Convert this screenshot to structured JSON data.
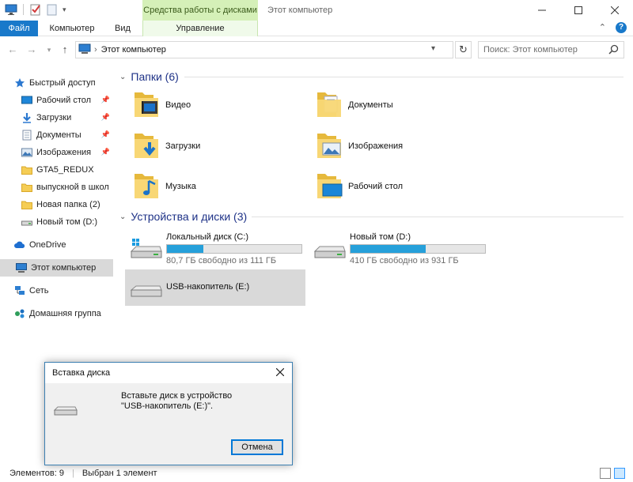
{
  "window": {
    "title": "Этот компьютер",
    "context_tab_header": "Средства работы с дисками"
  },
  "ribbon": {
    "tabs": [
      {
        "label": "Файл"
      },
      {
        "label": "Компьютер"
      },
      {
        "label": "Вид"
      },
      {
        "label": "Управление"
      }
    ]
  },
  "address": {
    "path": "Этот компьютер",
    "search_placeholder": "Поиск: Этот компьютер"
  },
  "nav": {
    "quick_access": "Быстрый доступ",
    "quick_items": [
      {
        "label": "Рабочий стол",
        "pinned": true
      },
      {
        "label": "Загрузки",
        "pinned": true
      },
      {
        "label": "Документы",
        "pinned": true
      },
      {
        "label": "Изображения",
        "pinned": true
      },
      {
        "label": "GTA5_REDUX",
        "pinned": false
      },
      {
        "label": "выпускной в школ",
        "pinned": false
      },
      {
        "label": "Новая папка (2)",
        "pinned": false
      },
      {
        "label": "Новый том (D:)",
        "pinned": false
      }
    ],
    "onedrive": "OneDrive",
    "this_pc": "Этот компьютер",
    "network": "Сеть",
    "homegroup": "Домашняя группа"
  },
  "main": {
    "folders_header": "Папки (6)",
    "folders": [
      {
        "label": "Видео",
        "icon": "video-folder-icon"
      },
      {
        "label": "Документы",
        "icon": "documents-folder-icon"
      },
      {
        "label": "Загрузки",
        "icon": "downloads-folder-icon"
      },
      {
        "label": "Изображения",
        "icon": "pictures-folder-icon"
      },
      {
        "label": "Музыка",
        "icon": "music-folder-icon"
      },
      {
        "label": "Рабочий стол",
        "icon": "desktop-folder-icon"
      }
    ],
    "drives_header": "Устройства и диски (3)",
    "drives": [
      {
        "name": "Локальный диск (C:)",
        "free": "80,7 ГБ свободно из 111 ГБ",
        "used_fraction": 0.27
      },
      {
        "name": "Новый том (D:)",
        "free": "410 ГБ свободно из 931 ГБ",
        "used_fraction": 0.56
      },
      {
        "name": "USB-накопитель (E:)"
      }
    ]
  },
  "status": {
    "items_count": "Элементов: 9",
    "selected": "Выбран 1 элемент"
  },
  "dialog": {
    "title": "Вставка диска",
    "message_line1": "Вставьте диск в устройство",
    "message_line2": "\"USB-накопитель (E:)\".",
    "cancel": "Отмена"
  },
  "colors": {
    "accent": "#1979ca",
    "drive_bar": "#26a0da",
    "selection": "#d9d9d9",
    "context_tab": "#d5f0b8",
    "section_header": "#1e3287"
  }
}
